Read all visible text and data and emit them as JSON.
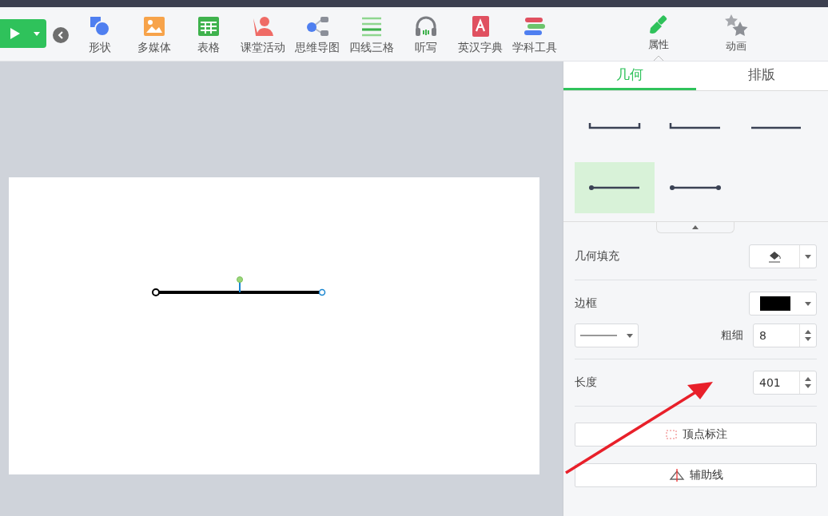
{
  "toolbar": {
    "tools": [
      {
        "label": "形状",
        "kind": "shapes"
      },
      {
        "label": "多媒体",
        "kind": "media"
      },
      {
        "label": "表格",
        "kind": "table"
      },
      {
        "label": "课堂活动",
        "kind": "activity"
      },
      {
        "label": "思维导图",
        "kind": "mindmap"
      },
      {
        "label": "四线三格",
        "kind": "lines"
      },
      {
        "label": "听写",
        "kind": "dictation"
      },
      {
        "label": "英汉字典",
        "kind": "dictionary"
      },
      {
        "label": "学科工具",
        "kind": "subject"
      }
    ]
  },
  "panel_tabs": [
    {
      "label": "属性",
      "kind": "properties",
      "selected": true
    },
    {
      "label": "动画",
      "kind": "animation",
      "selected": false
    }
  ],
  "sub_tabs": [
    {
      "label": "几何",
      "selected": true
    },
    {
      "label": "排版",
      "selected": false
    }
  ],
  "line_styles": [
    {
      "kind": "bracket-both",
      "selected": false
    },
    {
      "kind": "bracket-left",
      "selected": false
    },
    {
      "kind": "plain",
      "selected": false
    },
    {
      "kind": "dot-left",
      "selected": true
    },
    {
      "kind": "dot-both",
      "selected": false
    }
  ],
  "properties": {
    "fill_label": "几何填充",
    "border_label": "边框",
    "border_swatch": {
      "color": "#000000"
    },
    "thickness_label": "粗细",
    "thickness": "8",
    "length_label": "长度",
    "length": "401"
  },
  "buttons": [
    {
      "label": "顶点标注",
      "kind": "vertex"
    },
    {
      "label": "辅助线",
      "kind": "guide"
    }
  ]
}
